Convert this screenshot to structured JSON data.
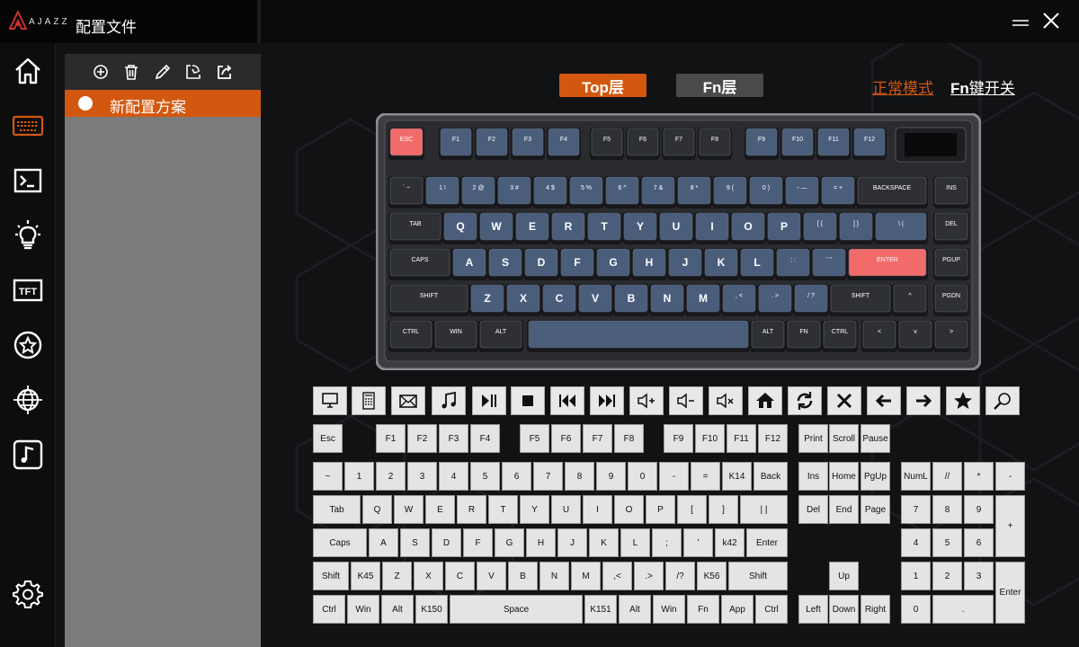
{
  "app": {
    "brand": "AJAZZ",
    "title": "配置文件"
  },
  "window_controls": {
    "minimize": "minimize-icon",
    "close": "close-icon"
  },
  "nav": [
    {
      "name": "home",
      "icon": "home-icon"
    },
    {
      "name": "keyboard",
      "icon": "keyboard-icon",
      "active": true
    },
    {
      "name": "macro",
      "icon": "terminal-icon"
    },
    {
      "name": "lighting",
      "icon": "lightbulb-icon"
    },
    {
      "name": "tft",
      "icon": "tft-icon",
      "text": "TFT"
    },
    {
      "name": "favorites",
      "icon": "star-circle-icon"
    },
    {
      "name": "network",
      "icon": "globe-icon"
    },
    {
      "name": "music",
      "icon": "music-icon"
    },
    {
      "name": "settings",
      "icon": "gear-icon"
    }
  ],
  "profile_toolbar": [
    "add-icon",
    "delete-icon",
    "edit-icon",
    "import-icon",
    "export-icon"
  ],
  "profile": {
    "selected": "新配置方案"
  },
  "layers": {
    "top": "Top层",
    "fn": "Fn层",
    "active": "top"
  },
  "modes": {
    "normal": "正常模式",
    "fn_switch_prefix": "Fn",
    "fn_switch_suffix": "键开关"
  },
  "accent": "#d3580f",
  "keyboard_legends": {
    "row0": [
      "ESC",
      "F1",
      "F2",
      "F3",
      "F4",
      "F5",
      "F6",
      "F7",
      "F8",
      "F9",
      "F10",
      "F11",
      "F12"
    ],
    "row1": [
      "` ~",
      "1 !",
      "2 @",
      "3 #",
      "4 $",
      "5 %",
      "6 ^",
      "7 &",
      "8 *",
      "9 (",
      "0 )",
      "- —",
      "= +",
      "BACKSPACE",
      "INS"
    ],
    "row2": [
      "TAB",
      "Q",
      "W",
      "E",
      "R",
      "T",
      "Y",
      "U",
      "I",
      "O",
      "P",
      "[ {",
      "] }",
      "\\ |",
      "DEL"
    ],
    "row3": [
      "CAPS",
      "A",
      "S",
      "D",
      "F",
      "G",
      "H",
      "J",
      "K",
      "L",
      "; :",
      "' \"",
      "ENTER",
      "PGUP"
    ],
    "row4": [
      "SHIFT",
      "Z",
      "X",
      "C",
      "V",
      "B",
      "N",
      "M",
      ", <",
      ". >",
      "/ ?",
      "SHIFT",
      "^",
      "PGDN"
    ],
    "row5": [
      "CTRL",
      "WIN",
      "ALT",
      "",
      "ALT",
      "FN",
      "CTRL",
      "<",
      "v",
      ">"
    ]
  },
  "function_icons": [
    "monitor-icon",
    "calculator-icon",
    "mail-icon",
    "music-note-icon",
    "play-pause-icon",
    "stop-icon",
    "previous-track-icon",
    "next-track-icon",
    "volume-up-icon",
    "volume-down-icon",
    "mute-icon",
    "home-page-icon",
    "refresh-icon",
    "close-x-icon",
    "arrow-left-icon",
    "arrow-right-icon",
    "favorite-star-icon",
    "search-icon"
  ],
  "vkeys": {
    "row_f": [
      "Esc",
      "F1",
      "F2",
      "F3",
      "F4",
      "F5",
      "F6",
      "F7",
      "F8",
      "F9",
      "F10",
      "F11",
      "F12",
      "Print",
      "Scroll",
      "Pause"
    ],
    "row_num": [
      "~",
      "1",
      "2",
      "3",
      "4",
      "5",
      "6",
      "7",
      "8",
      "9",
      "0",
      "-",
      "=",
      "K14",
      "Back",
      "Ins",
      "Home",
      "PgUp",
      "NumL",
      "//",
      "*",
      "-"
    ],
    "row_tab": [
      "Tab",
      "Q",
      "W",
      "E",
      "R",
      "T",
      "Y",
      "U",
      "I",
      "O",
      "P",
      "[",
      "]",
      "| |",
      "Del",
      "End",
      "Page",
      "7",
      "8",
      "9",
      "+"
    ],
    "row_caps": [
      "Caps",
      "A",
      "S",
      "D",
      "F",
      "G",
      "H",
      "J",
      "K",
      "L",
      ";",
      "'",
      "k42",
      "Enter",
      "4",
      "5",
      "6"
    ],
    "row_shift": [
      "Shift",
      "K45",
      "Z",
      "X",
      "C",
      "V",
      "B",
      "N",
      "M",
      ",<",
      ".>",
      "/?",
      "K56",
      "Shift",
      "Up",
      "1",
      "2",
      "3",
      "Enter"
    ],
    "row_ctrl": [
      "Ctrl",
      "Win",
      "Alt",
      "K150",
      "Space",
      "K151",
      "Alt",
      "Win",
      "Fn",
      "App",
      "Ctrl",
      "Left",
      "Down",
      "Right",
      "0",
      "."
    ]
  }
}
